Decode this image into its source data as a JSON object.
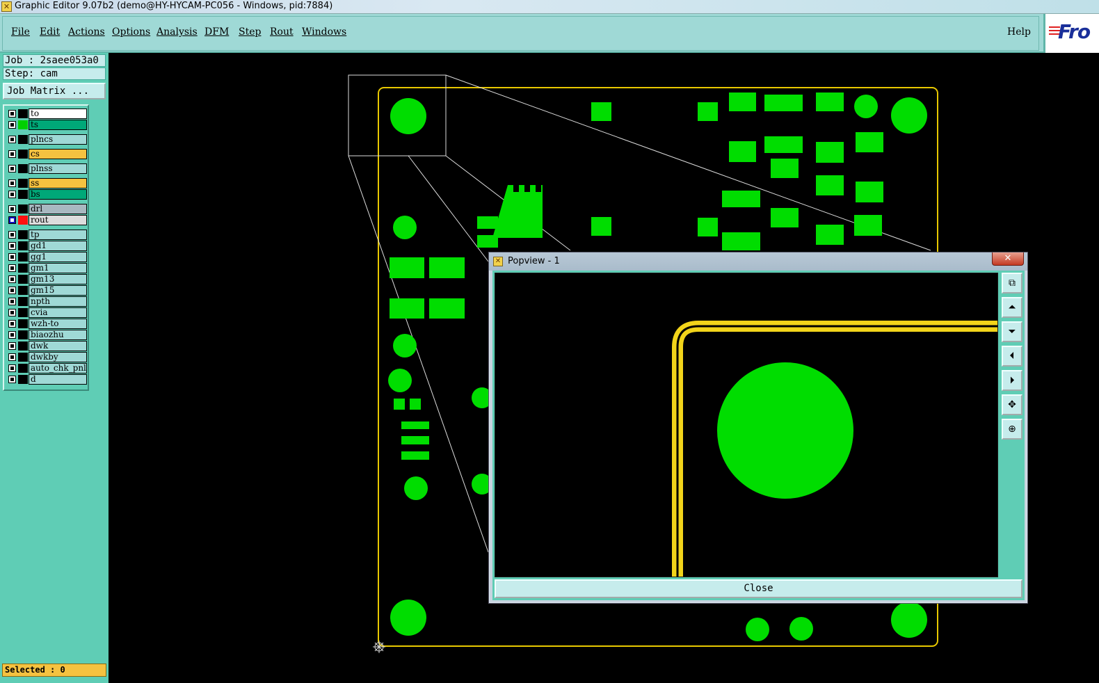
{
  "titlebar": {
    "icon": "x-app-icon",
    "title": "Graphic Editor 9.07b2 (demo@HY-HYCAM-PC056 - Windows, pid:7884)"
  },
  "menu": {
    "items": [
      "File",
      "Edit",
      "Actions",
      "Options",
      "Analysis",
      "DFM",
      "Step",
      "Rout",
      "Windows"
    ],
    "help": "Help",
    "logo_text": "Fro"
  },
  "left": {
    "job": "Job : 2saee053a0",
    "step": "Step: cam",
    "job_matrix": "Job Matrix ...",
    "selected": "Selected : 0"
  },
  "layers": [
    {
      "name": "to",
      "checked": false,
      "swatch": "#000000",
      "bg": "#ffffff"
    },
    {
      "name": "ts",
      "checked": false,
      "swatch": "#00d000",
      "bg": "#00a878"
    },
    {
      "name": "plncs",
      "checked": false,
      "swatch": "#000000",
      "bg": "#9fd9d6"
    },
    {
      "name": "cs",
      "checked": false,
      "swatch": "#000000",
      "bg": "#f5c240"
    },
    {
      "name": "plnss",
      "checked": false,
      "swatch": "#000000",
      "bg": "#9fd9d6"
    },
    {
      "name": "ss",
      "checked": false,
      "swatch": "#000000",
      "bg": "#f5c240"
    },
    {
      "name": "bs",
      "checked": false,
      "swatch": "#000000",
      "bg": "#00a878"
    },
    {
      "name": "drl",
      "checked": false,
      "swatch": "#000000",
      "bg": "#a8b8c0"
    },
    {
      "name": "rout",
      "checked": true,
      "swatch": "#ff1010",
      "bg": "#dcdcdc"
    },
    {
      "name": "tp",
      "checked": false,
      "swatch": "#000000",
      "bg": "#9fd9d6"
    },
    {
      "name": "gd1",
      "checked": false,
      "swatch": "#000000",
      "bg": "#9fd9d6"
    },
    {
      "name": "gg1",
      "checked": false,
      "swatch": "#000000",
      "bg": "#9fd9d6"
    },
    {
      "name": "gm1",
      "checked": false,
      "swatch": "#000000",
      "bg": "#9fd9d6"
    },
    {
      "name": "gm13",
      "checked": false,
      "swatch": "#000000",
      "bg": "#9fd9d6"
    },
    {
      "name": "gm15",
      "checked": false,
      "swatch": "#000000",
      "bg": "#9fd9d6"
    },
    {
      "name": "npth",
      "checked": false,
      "swatch": "#000000",
      "bg": "#9fd9d6"
    },
    {
      "name": "cvia",
      "checked": false,
      "swatch": "#000000",
      "bg": "#9fd9d6"
    },
    {
      "name": "wzh-to",
      "checked": false,
      "swatch": "#000000",
      "bg": "#9fd9d6"
    },
    {
      "name": "biaozhu",
      "checked": false,
      "swatch": "#000000",
      "bg": "#9fd9d6"
    },
    {
      "name": "dwk",
      "checked": false,
      "swatch": "#000000",
      "bg": "#9fd9d6"
    },
    {
      "name": "dwkby",
      "checked": false,
      "swatch": "#000000",
      "bg": "#9fd9d6"
    },
    {
      "name": "auto_chk_pnl",
      "checked": false,
      "swatch": "#000000",
      "bg": "#9fd9d6"
    },
    {
      "name": "d",
      "checked": false,
      "swatch": "#000000",
      "bg": "#9fd9d6"
    }
  ],
  "popview": {
    "title": "Popview - 1",
    "close_x": "✕",
    "close_button": "Close",
    "tools": [
      "zoom-fit-icon",
      "pan-up-icon",
      "pan-down-icon",
      "pan-left-icon",
      "pan-right-icon",
      "zoom-in-icon",
      "zoom-out-icon"
    ]
  },
  "colors": {
    "pad": "#00dd00",
    "outline": "#e8c800",
    "panel": "#5fcdb5",
    "menubar": "#9fd9d6"
  }
}
